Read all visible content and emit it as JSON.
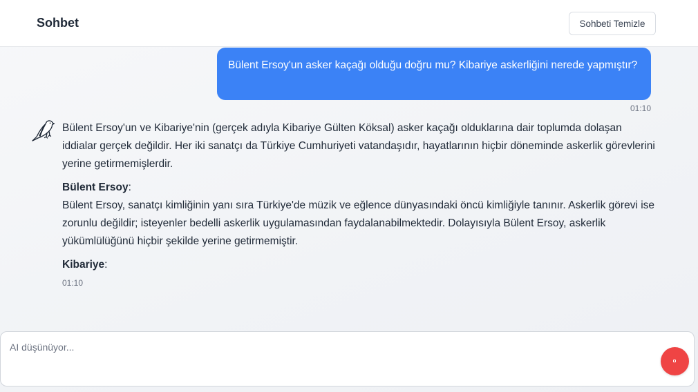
{
  "header": {
    "title": "Sohbet",
    "clear_button_label": "Sohbeti Temizle"
  },
  "messages": {
    "user": {
      "text": "Bülent Ersoy'un asker kaçağı olduğu doğru mu? Kibariye askerliğini nerede yapmıştır?",
      "time": "01:10"
    },
    "assistant": {
      "avatar_icon": "bird-icon",
      "intro": "Bülent Ersoy'un ve Kibariye'nin (gerçek adıyla Kibariye Gülten Köksal) asker kaçağı olduklarına dair toplumda dolaşan iddialar gerçek değildir. Her iki sanatçı da Türkiye Cumhuriyeti vatandaşıdır, hayatlarının hiçbir döneminde askerlik görevlerini yerine getirmemişlerdir.",
      "sections": [
        {
          "heading": "Bülent Ersoy",
          "body": "Bülent Ersoy, sanatçı kimliğinin yanı sıra Türkiye'de müzik ve eğlence dünyasındaki öncü kimliğiyle tanınır. Askerlik görevi ise zorunlu değildir; isteyenler bedelli askerlik uygulamasından faydalanabilmektedir. Dolayısıyla Bülent Ersoy, askerlik yükümlülüğünü hiçbir şekilde yerine getirmemiştir."
        },
        {
          "heading": "Kibariye",
          "body": ""
        }
      ],
      "time": "01:10"
    }
  },
  "composer": {
    "placeholder": "AI düşünüyor...",
    "stop_icon": "stop-icon"
  },
  "colors": {
    "user_bubble": "#3b82f6",
    "stop_button": "#ef4444"
  }
}
